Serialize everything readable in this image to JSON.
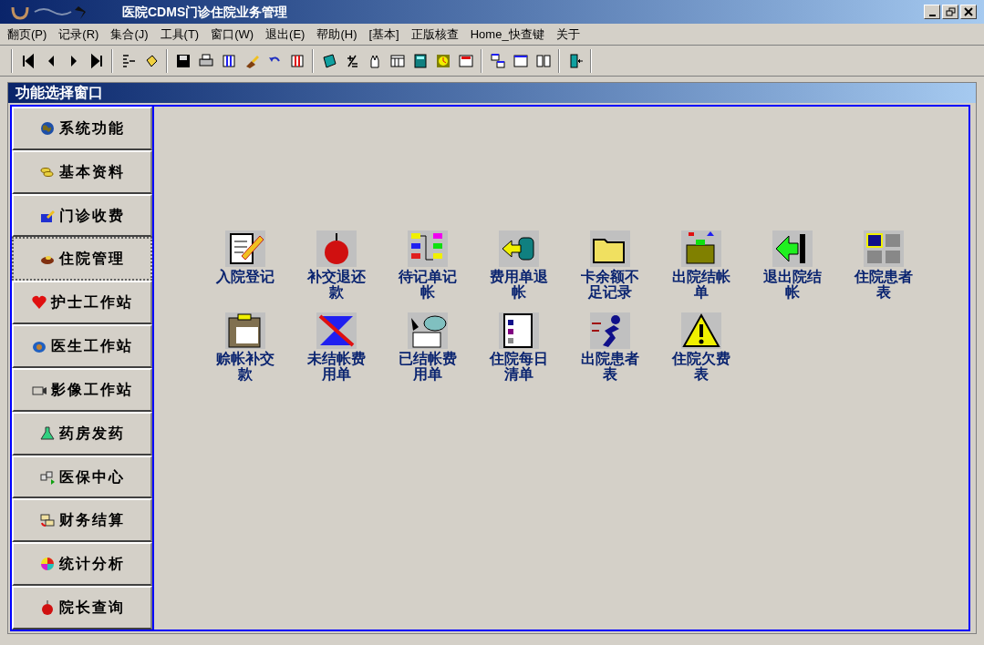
{
  "window": {
    "title": "医院CDMS门诊住院业务管理"
  },
  "menu": [
    "翻页(P)",
    "记录(R)",
    "集合(J)",
    "工具(T)",
    "窗口(W)",
    "退出(E)",
    "帮助(H)",
    "[基本]",
    "正版核查",
    "Home_快查键",
    "关于"
  ],
  "child_window": {
    "title": "功能选择窗口"
  },
  "sidebar": {
    "items": [
      {
        "label": "系统功能",
        "selected": false
      },
      {
        "label": "基本资料",
        "selected": false
      },
      {
        "label": "门诊收费",
        "selected": false
      },
      {
        "label": "住院管理",
        "selected": true
      },
      {
        "label": "护士工作站",
        "selected": false
      },
      {
        "label": "医生工作站",
        "selected": false
      },
      {
        "label": "影像工作站",
        "selected": false
      },
      {
        "label": "药房发药",
        "selected": false
      },
      {
        "label": "医保中心",
        "selected": false
      },
      {
        "label": "财务结算",
        "selected": false
      },
      {
        "label": "统计分析",
        "selected": false
      },
      {
        "label": "院长查询",
        "selected": false
      }
    ]
  },
  "functions": [
    {
      "label": "入院登记"
    },
    {
      "label": "补交退还款"
    },
    {
      "label": "待记单记帐"
    },
    {
      "label": "费用单退帐"
    },
    {
      "label": "卡余额不足记录"
    },
    {
      "label": "出院结帐单"
    },
    {
      "label": "退出院结帐"
    },
    {
      "label": "住院患者表"
    },
    {
      "label": "赊帐补交款"
    },
    {
      "label": "未结帐费用单"
    },
    {
      "label": "已结帐费用单"
    },
    {
      "label": "住院每日清单"
    },
    {
      "label": "出院患者表"
    },
    {
      "label": "住院欠费表"
    }
  ]
}
